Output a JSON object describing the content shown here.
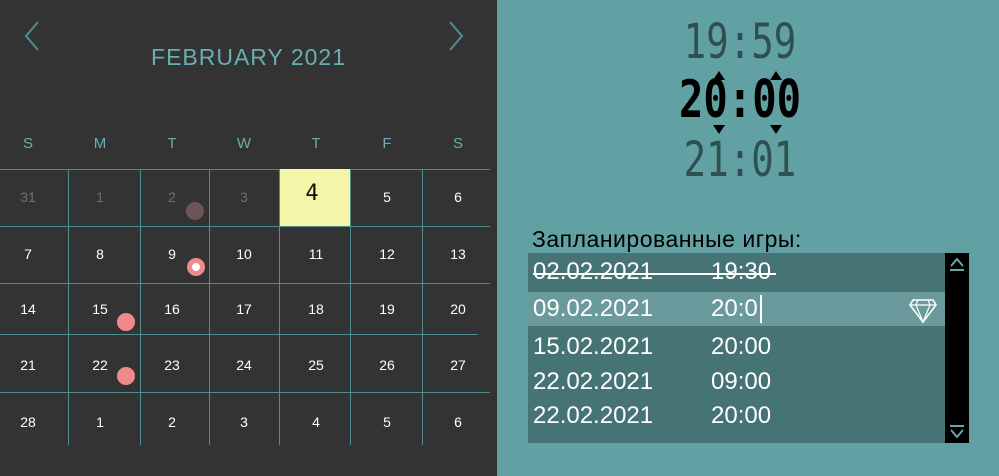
{
  "calendar": {
    "month_title": "FEBRUARY 2021",
    "weekdays": [
      "S",
      "M",
      "T",
      "W",
      "T",
      "F",
      "S"
    ],
    "weeks": [
      [
        "31",
        "1",
        "2",
        "3",
        "4",
        "5",
        "6"
      ],
      [
        "7",
        "8",
        "9",
        "10",
        "11",
        "12",
        "13"
      ],
      [
        "14",
        "15",
        "16",
        "17",
        "18",
        "19",
        "20"
      ],
      [
        "21",
        "22",
        "23",
        "24",
        "25",
        "26",
        "27"
      ],
      [
        "28",
        "1",
        "2",
        "3",
        "4",
        "5",
        "6"
      ]
    ],
    "selected_day": "4",
    "colors": {
      "background": "#333333",
      "accent": "#69aeb2",
      "today": "#f4f5a8",
      "marker_past": "#6d5556",
      "marker_future": "#f08a8a"
    }
  },
  "time_picker": {
    "previous": "19:59",
    "current": "20:00",
    "next": "21:01"
  },
  "games": {
    "title": "Запланированные игры:",
    "items": [
      {
        "date": "02.02.2021",
        "time": "19:30",
        "status": "cancelled"
      },
      {
        "date": "09.02.2021",
        "time": "20:0",
        "status": "editing"
      },
      {
        "date": "15.02.2021",
        "time": "20:00",
        "status": "scheduled"
      },
      {
        "date": "22.02.2021",
        "time": "09:00",
        "status": "scheduled"
      },
      {
        "date": "22.02.2021",
        "time": "20:00",
        "status": "scheduled"
      }
    ],
    "icons": {
      "row_action": "diamond-icon",
      "scroll_up": "chevron-up-icon",
      "scroll_down": "chevron-down-icon"
    }
  }
}
